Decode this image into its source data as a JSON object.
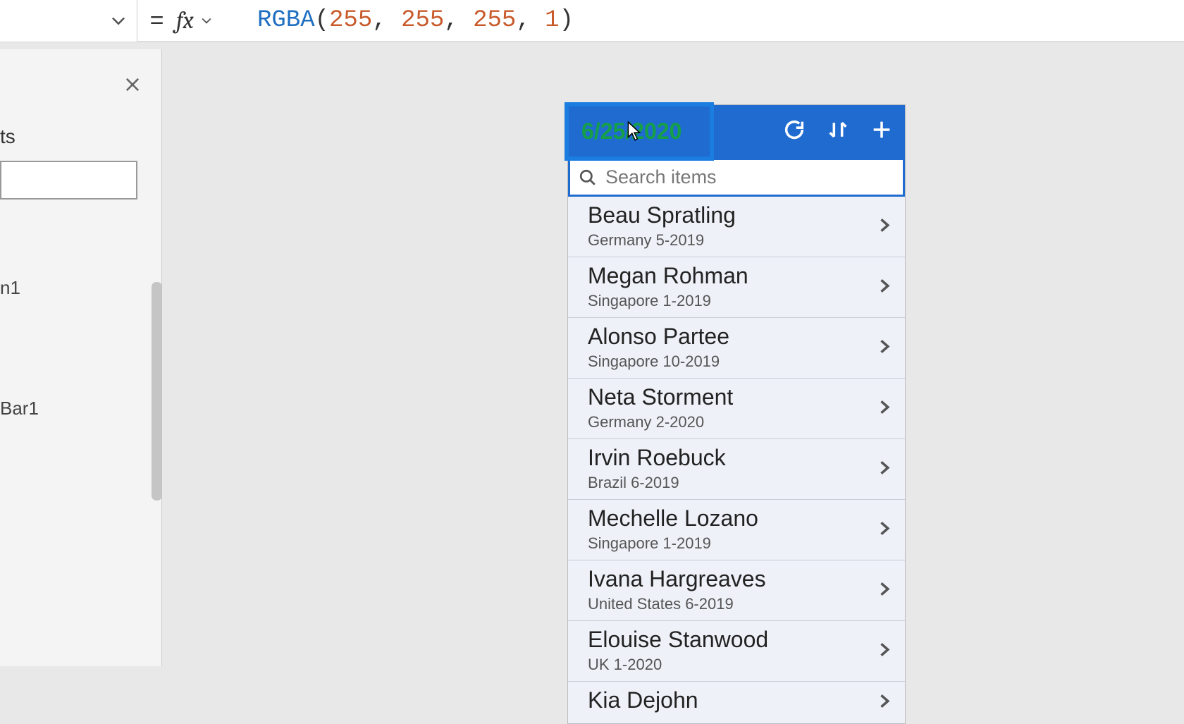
{
  "formula_bar": {
    "equals": "=",
    "fx": "fx",
    "fn_name": "RGBA",
    "open": "(",
    "args": [
      "255",
      "255",
      "255",
      "1"
    ],
    "comma": ", ",
    "close": ")"
  },
  "left_panel": {
    "heading": "ts",
    "item1": "n1",
    "item2": "Bar1"
  },
  "app": {
    "title": "6/25/2020",
    "search_placeholder": "Search items",
    "items": [
      {
        "title": "Beau Spratling",
        "sub": "Germany 5-2019"
      },
      {
        "title": "Megan Rohman",
        "sub": "Singapore 1-2019"
      },
      {
        "title": "Alonso Partee",
        "sub": "Singapore 10-2019"
      },
      {
        "title": "Neta Storment",
        "sub": "Germany 2-2020"
      },
      {
        "title": "Irvin Roebuck",
        "sub": "Brazil 6-2019"
      },
      {
        "title": "Mechelle Lozano",
        "sub": "Singapore 1-2019"
      },
      {
        "title": "Ivana Hargreaves",
        "sub": "United States 6-2019"
      },
      {
        "title": "Elouise Stanwood",
        "sub": "UK 1-2020"
      },
      {
        "title": "Kia Dejohn",
        "sub": ""
      }
    ]
  }
}
